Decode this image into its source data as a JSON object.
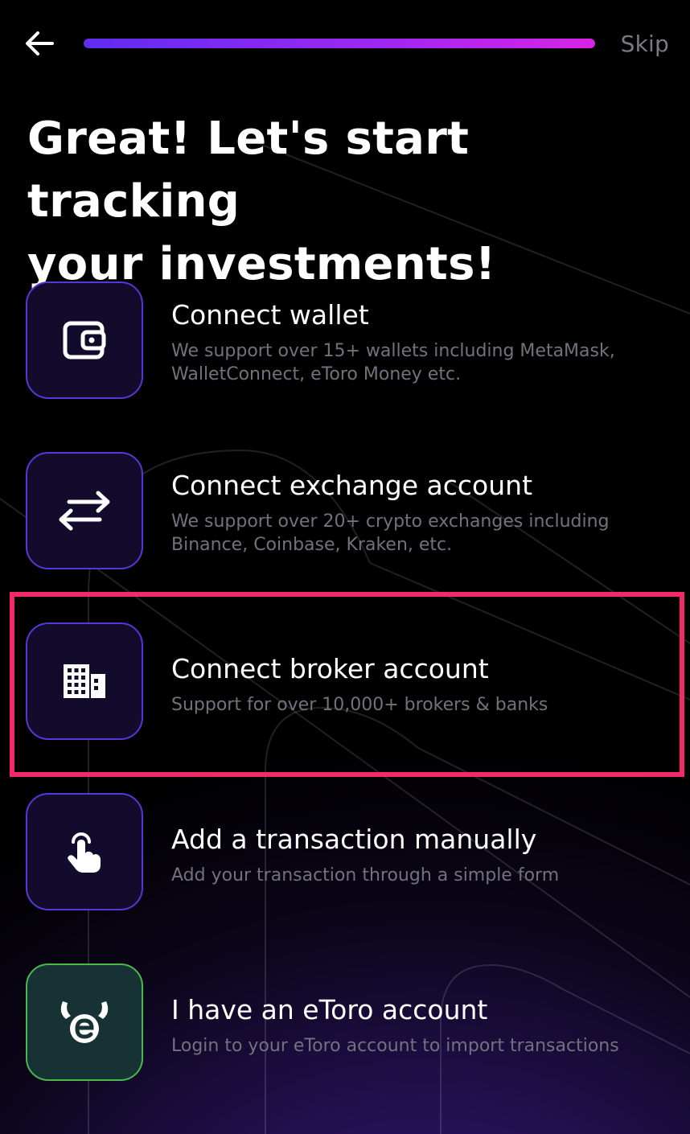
{
  "top_bar": {
    "back_icon": "arrow-left-icon",
    "progress_value": 1.0,
    "skip_label": "Skip"
  },
  "title": {
    "line1": "Great! Let's start tracking",
    "line2": "your investments!"
  },
  "options": [
    {
      "icon": "wallet-icon",
      "title": "Connect wallet",
      "description": "We support over 15+ wallets including MetaMask, WalletConnect, eToro Money etc."
    },
    {
      "icon": "exchange-arrows-icon",
      "title": "Connect exchange account",
      "description": "We support over 20+ crypto exchanges including Binance, Coinbase, Kraken, etc."
    },
    {
      "icon": "building-icon",
      "title": "Connect broker account",
      "description": "Support for over 10,000+ brokers & banks"
    },
    {
      "icon": "hand-tap-icon",
      "title": "Add a transaction manually",
      "description": "Add your transaction through a simple form"
    },
    {
      "icon": "etoro-logo-icon",
      "title": "I have an eToro account",
      "description": "Login to your eToro account to import transactions"
    }
  ],
  "colors": {
    "background": "#000000",
    "accent_purple": "#5a35d8",
    "progress_start": "#5f2df0",
    "progress_end": "#d923e8",
    "etoro_green": "#49b94a",
    "highlight": "#f5286a",
    "muted_text": "#72727e"
  },
  "highlighted_option": "Connect broker account"
}
